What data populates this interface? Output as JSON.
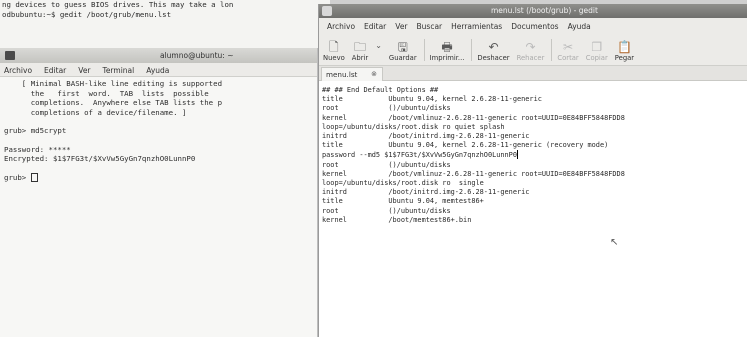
{
  "bg_terminal": {
    "lines": [
      "ng devices to guess BIOS drives. This may take a lon",
      "odbubuntu:~$ gedit /boot/grub/menu.lst"
    ]
  },
  "terminal": {
    "title": "alumno@ubuntu: ~",
    "menu": [
      "Archivo",
      "Editar",
      "Ver",
      "Terminal",
      "Ayuda"
    ],
    "lines_help": [
      "    [ Minimal BASH-like line editing is supported",
      "      the   first  word.  TAB  lists  possible",
      "      completions.  Anywhere else TAB lists the p",
      "      completions of a device/filename. ]"
    ],
    "cmd_md5": "grub> md5crypt",
    "password_line": "Password: *****",
    "encrypted_line": "Encrypted: $1$7FG3t/$XvVw5GyGn7qnzhO0LunnP0",
    "prompt": "grub> "
  },
  "gedit": {
    "title": "menu.lst (/boot/grub) - gedit",
    "menu": [
      "Archivo",
      "Editar",
      "Ver",
      "Buscar",
      "Herramientas",
      "Documentos",
      "Ayuda"
    ],
    "toolbar": {
      "nuevo": "Nuevo",
      "abrir": "Abrir",
      "guardar": "Guardar",
      "imprimir": "Imprimir...",
      "deshacer": "Deshacer",
      "rehacer": "Rehacer",
      "cortar": "Cortar",
      "copiar": "Copiar",
      "pegar": "Pegar"
    },
    "tab_label": "menu.lst",
    "editor_lines": [
      "## ## End Default Options ##",
      "",
      "title           Ubuntu 9.04, kernel 2.6.28-11-generic",
      "root            ()/ubuntu/disks",
      "kernel          /boot/vmlinuz-2.6.28-11-generic root=UUID=0E84BFF5848FDD8",
      "loop=/ubuntu/disks/root.disk ro quiet splash",
      "initrd          /boot/initrd.img-2.6.28-11-generic",
      "",
      "title           Ubuntu 9.04, kernel 2.6.28-11-generic (recovery mode)",
      "password --md5 $1$7FG3t/$XvVw5GyGn7qnzhO0LunnP0",
      "root            ()/ubuntu/disks",
      "kernel          /boot/vmlinuz-2.6.28-11-generic root=UUID=0E84BFF5848FDD8",
      "loop=/ubuntu/disks/root.disk ro  single",
      "initrd          /boot/initrd.img-2.6.28-11-generic",
      "",
      "title           Ubuntu 9.04, memtest86+",
      "root            ()/ubuntu/disks",
      "kernel          /boot/memtest86+.bin"
    ]
  }
}
